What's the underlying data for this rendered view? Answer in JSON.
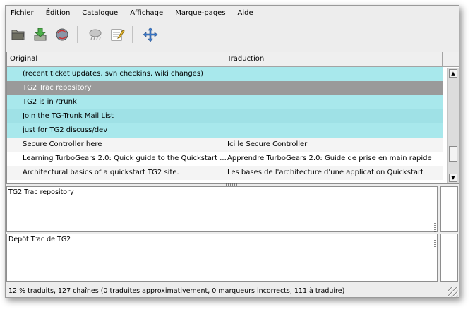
{
  "menubar": {
    "items": [
      {
        "pre": "",
        "mn": "F",
        "post": "ichier"
      },
      {
        "pre": "",
        "mn": "É",
        "post": "dition"
      },
      {
        "pre": "",
        "mn": "C",
        "post": "atalogue"
      },
      {
        "pre": "",
        "mn": "A",
        "post": "ffichage"
      },
      {
        "pre": "",
        "mn": "M",
        "post": "arque-pages"
      },
      {
        "pre": "Ai",
        "mn": "d",
        "post": "e"
      }
    ]
  },
  "toolbar": {
    "icons": [
      "open-icon",
      "save-icon",
      "update-icon",
      "weather-icon",
      "edit-notes-icon",
      "move-icon"
    ]
  },
  "table": {
    "headers": {
      "original": "Original",
      "translation": "Traduction"
    },
    "rows": [
      {
        "original": "(recent ticket updates, svn checkins, wiki changes)",
        "translation": "",
        "state": "fuzzy-a"
      },
      {
        "original": "TG2 Trac repository",
        "translation": "",
        "state": "selected"
      },
      {
        "original": "TG2 is in /trunk",
        "translation": "",
        "state": "fuzzy-a"
      },
      {
        "original": "Join the TG-Trunk Mail List",
        "translation": "",
        "state": "fuzzy-b"
      },
      {
        "original": "just for TG2 discuss/dev",
        "translation": "",
        "state": "fuzzy-a"
      },
      {
        "original": "Secure Controller here",
        "translation": "Ici le Secure Controller",
        "state": "plain-a"
      },
      {
        "original": "Learning TurboGears 2.0: Quick guide to the Quickstart ...",
        "translation": "Apprendre TurboGears 2.0: Guide de prise en main rapide",
        "state": "plain-b"
      },
      {
        "original": "Architectural basics of a quickstart TG2 site.",
        "translation": "Les bases de l'architecture d'une application Quickstart",
        "state": "plain-a"
      }
    ]
  },
  "source_pane": {
    "text": "TG2 Trac repository"
  },
  "target_pane": {
    "text": "Dépôt Trac de TG2"
  },
  "status": {
    "text": "12 % traduits, 127 chaînes (0 traduites approximativement, 0 marqueurs incorrects, 111 à traduire)"
  },
  "colors": {
    "fuzzy": "#a8e8ec",
    "selected": "#9a9a9a",
    "window_bg": "#ededed"
  }
}
